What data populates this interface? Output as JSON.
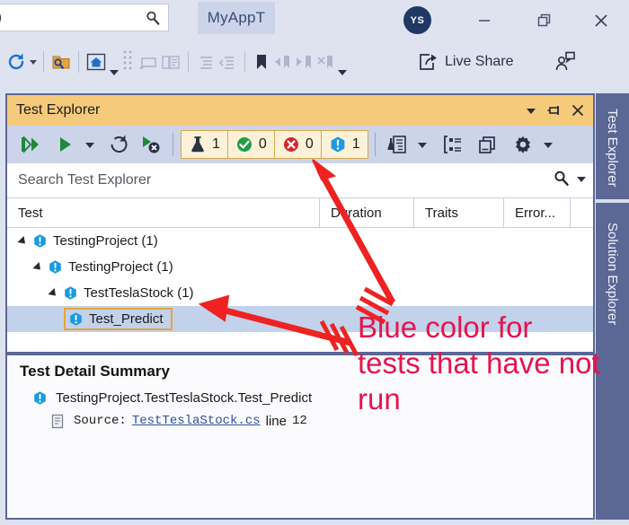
{
  "window": {
    "search_value": ")",
    "search_icon": "search-icon",
    "tab_label": "MyAppT",
    "avatar_initials": "YS",
    "minimize_label": "Minimize",
    "restore_label": "Restore",
    "close_label": "Close"
  },
  "toolbar": {
    "refresh_icon": "refresh-icon",
    "refresh_dropdown_icon": "chevron-down-icon",
    "find_folder_icon": "find-in-folder-icon",
    "home_icon": "home-icon",
    "home_dropdown_icon": "chevron-down-icon",
    "dotted_icon": "dotted-column-icon",
    "comment_icon": "comment-icon",
    "copy_comment_icon": "copy-comment-icon",
    "indent_icon": "indent-icon",
    "outdent_icon": "outdent-icon",
    "bookmark_icon": "bookmark-icon",
    "prev_bookmark_icon": "previous-bookmark-icon",
    "next_bookmark_icon": "next-bookmark-icon",
    "clear_bookmark_icon": "clear-bookmark-icon",
    "overflow_icon": "toolbar-overflow-icon",
    "live_share_icon": "live-share-icon",
    "live_share_label": "Live Share",
    "feedback_icon": "send-feedback-icon"
  },
  "test_explorer": {
    "title": "Test Explorer",
    "header_dropdown_icon": "chevron-down-icon",
    "pin_icon": "pin-icon",
    "close_icon": "close-icon",
    "run_all_icon": "run-all-tests-icon",
    "run_icon": "run-tests-icon",
    "run_dropdown_icon": "chevron-down-icon",
    "repeat_icon": "repeat-last-run-icon",
    "cancel_icon": "cancel-run-icon",
    "counters": [
      {
        "name": "total",
        "icon": "flask-icon",
        "value": "1",
        "color": "#2b3340"
      },
      {
        "name": "passed",
        "icon": "check-circle-icon",
        "value": "0",
        "color": "#1e9e47"
      },
      {
        "name": "failed",
        "icon": "error-circle-icon",
        "value": "0",
        "color": "#d3282b"
      },
      {
        "name": "not-run",
        "icon": "info-hexagon-icon",
        "value": "1",
        "color": "#1b9ae0"
      }
    ],
    "output_icon": "test-output-icon",
    "output_dropdown_icon": "chevron-down-icon",
    "group_by_icon": "group-by-icon",
    "columns_icon": "columns-icon",
    "settings_icon": "gear-icon",
    "settings_dropdown_icon": "chevron-down-icon",
    "search_placeholder": "Search Test Explorer",
    "search_icon": "search-icon",
    "search_dropdown_icon": "chevron-down-icon",
    "columns": [
      "Test",
      "Duration",
      "Traits",
      "Error..."
    ],
    "tree": [
      {
        "label": "TestingProject (1)",
        "depth": 0,
        "icon": "info-hexagon-icon",
        "expander": "expanded-triangle-icon",
        "selected": false,
        "boxed": false
      },
      {
        "label": "TestingProject (1)",
        "depth": 1,
        "icon": "info-hexagon-icon",
        "expander": "expanded-triangle-icon",
        "selected": false,
        "boxed": false
      },
      {
        "label": "TestTeslaStock (1)",
        "depth": 2,
        "icon": "info-hexagon-icon",
        "expander": "expanded-triangle-icon",
        "selected": false,
        "boxed": false
      },
      {
        "label": "Test_Predict",
        "depth": 3,
        "icon": "info-hexagon-icon",
        "expander": "",
        "selected": true,
        "boxed": true
      }
    ]
  },
  "detail": {
    "title": "Test Detail Summary",
    "test_icon": "info-hexagon-icon",
    "test_name": "TestingProject.TestTeslaStock.Test_Predict",
    "source_icon": "source-file-icon",
    "source_label": "Source:",
    "source_link": "TestTeslaStock.cs",
    "line_label": "line",
    "line_number": "12"
  },
  "right_tabs": [
    {
      "label": "Test Explorer"
    },
    {
      "label": "Solution Explorer"
    }
  ],
  "annotation": {
    "text": "Blue color for tests that have not run",
    "color": "#e6134f",
    "arrow_1": "arrow-to-not-run-counter",
    "arrow_2": "arrow-to-test-predict-row"
  }
}
